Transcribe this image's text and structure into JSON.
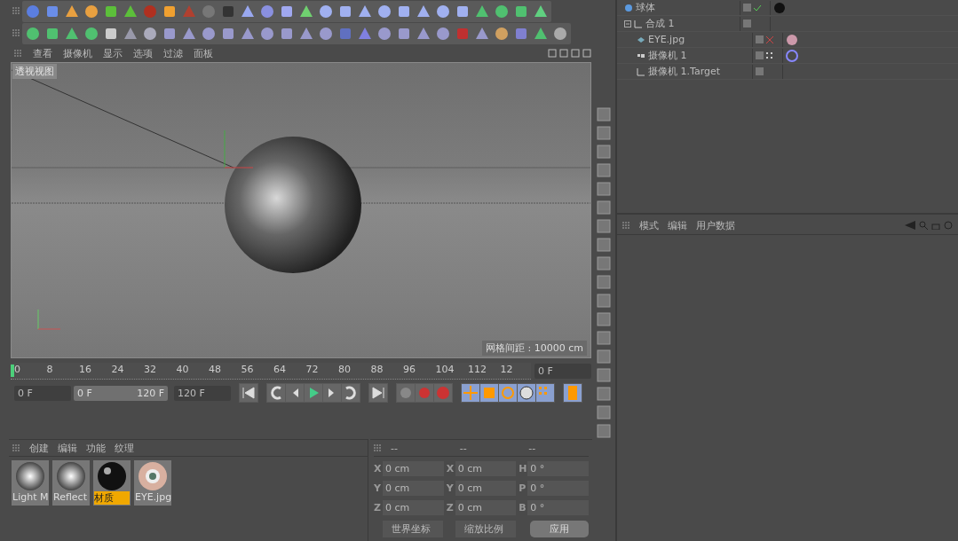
{
  "viewport_menu": [
    "查看",
    "摄像机",
    "显示",
    "选项",
    "过滤",
    "面板"
  ],
  "viewport": {
    "title": "透视视图",
    "grid_label": "网格间距 : 10000 cm"
  },
  "timeline": {
    "ticks": [
      "0",
      "8",
      "16",
      "24",
      "32",
      "40",
      "48",
      "56",
      "64",
      "72",
      "80",
      "88",
      "96",
      "104",
      "112",
      "12"
    ],
    "level": 0.0,
    "current_frame": "0 F"
  },
  "transport": {
    "start": "0 F",
    "range_start": "0 F",
    "range_end": "120 F",
    "level": 1,
    "end": "120 F"
  },
  "materials_menu": [
    "创建",
    "编辑",
    "功能",
    "纹理"
  ],
  "materials": [
    {
      "name": "Light M",
      "kind": "chrome",
      "selected": false
    },
    {
      "name": "Reflect",
      "kind": "chrome",
      "selected": false
    },
    {
      "name": "材质",
      "kind": "black",
      "selected": true
    },
    {
      "name": "EYE.jpg",
      "kind": "eye",
      "selected": false
    }
  ],
  "coordinates": {
    "headers": [
      "--",
      "--",
      "--"
    ],
    "rows": [
      {
        "fields": [
          {
            "axis": "X",
            "value": "0 cm"
          },
          {
            "axis": "X",
            "value": "0 cm"
          },
          {
            "axis": "H",
            "value": "0 °"
          }
        ]
      },
      {
        "fields": [
          {
            "axis": "Y",
            "value": "0 cm"
          },
          {
            "axis": "Y",
            "value": "0 cm"
          },
          {
            "axis": "P",
            "value": "0 °"
          }
        ]
      },
      {
        "fields": [
          {
            "axis": "Z",
            "value": "0 cm"
          },
          {
            "axis": "Z",
            "value": "0 cm"
          },
          {
            "axis": "B",
            "value": "0 °"
          }
        ]
      }
    ],
    "dropdowns": [
      "世界坐标",
      "缩放比例"
    ],
    "apply": "应用"
  },
  "objects": [
    {
      "name": "球体",
      "kind": "sphere",
      "status_icon": {
        "kind": "check"
      },
      "tags": [
        {
          "kind": "material"
        }
      ]
    },
    {
      "name": "合成 1",
      "kind": "null",
      "expanded": true,
      "children": [
        {
          "name": "EYE.jpg",
          "kind": "image",
          "status_icon": {
            "kind": "cross"
          },
          "tags": [
            {
              "kind": "texture"
            }
          ]
        },
        {
          "name": "摄像机 1",
          "kind": "camera",
          "status_icon": {
            "kind": "dots"
          },
          "tags": [
            {
              "kind": "target"
            }
          ]
        },
        {
          "name": "摄像机 1.Target",
          "kind": "null"
        }
      ]
    }
  ],
  "attributes_menu": [
    "模式",
    "编辑",
    "用户数据"
  ]
}
